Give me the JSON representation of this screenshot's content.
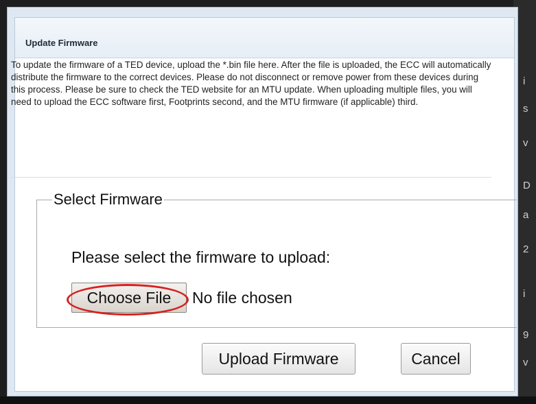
{
  "dialog": {
    "title": "Update Firmware",
    "instructions": "To update the firmware of a TED device, upload the *.bin file here. After the file is uploaded, the ECC will automatically distribute the firmware to the correct devices. Please do not disconnect or remove power from these devices during this process. Please be sure to check the TED website for an MTU update. When uploading multiple files, you will need to upload the ECC software first, Footprints second, and the MTU firmware (if applicable) third."
  },
  "select_firmware": {
    "legend": "Select Firmware",
    "prompt": "Please select the firmware to upload:",
    "choose_file_label": "Choose File",
    "file_status": "No file chosen"
  },
  "actions": {
    "upload_label": "Upload Firmware",
    "cancel_label": "Cancel"
  },
  "annotation": {
    "highlight_color": "#d62020"
  }
}
